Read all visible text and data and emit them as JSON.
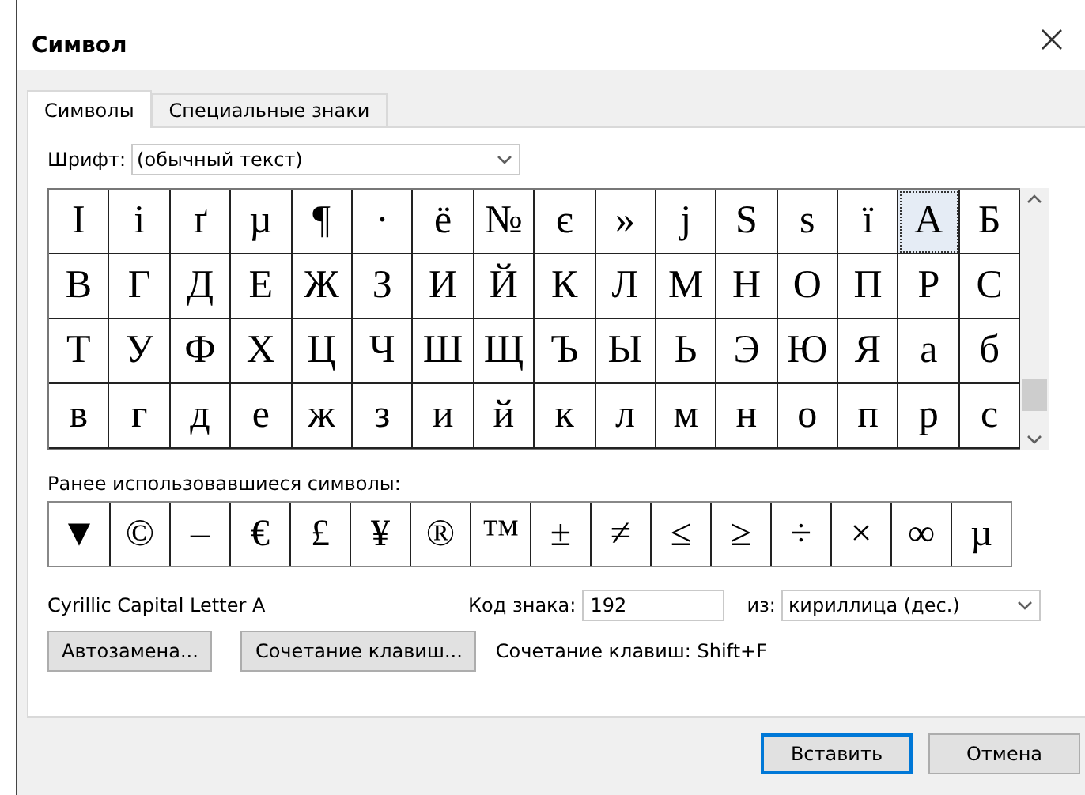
{
  "window": {
    "title": "Символ"
  },
  "tabs": [
    {
      "label": "Символы",
      "selected": true
    },
    {
      "label": "Специальные знаки",
      "selected": false
    }
  ],
  "font": {
    "label": "Шрифт:",
    "value": "(обычный текст)"
  },
  "symbols": [
    {
      "char": "І",
      "selected": false
    },
    {
      "char": "і",
      "selected": false
    },
    {
      "char": "ґ",
      "selected": false
    },
    {
      "char": "µ",
      "selected": false
    },
    {
      "char": "¶",
      "selected": false
    },
    {
      "char": "·",
      "selected": false
    },
    {
      "char": "ё",
      "selected": false
    },
    {
      "char": "№",
      "selected": false
    },
    {
      "char": "є",
      "selected": false
    },
    {
      "char": "»",
      "selected": false
    },
    {
      "char": "ј",
      "selected": false
    },
    {
      "char": "Ѕ",
      "selected": false
    },
    {
      "char": "ѕ",
      "selected": false
    },
    {
      "char": "ї",
      "selected": false
    },
    {
      "char": "А",
      "selected": true
    },
    {
      "char": "Б",
      "selected": false
    },
    {
      "char": "В",
      "selected": false
    },
    {
      "char": "Г",
      "selected": false
    },
    {
      "char": "Д",
      "selected": false
    },
    {
      "char": "Е",
      "selected": false
    },
    {
      "char": "Ж",
      "selected": false
    },
    {
      "char": "З",
      "selected": false
    },
    {
      "char": "И",
      "selected": false
    },
    {
      "char": "Й",
      "selected": false
    },
    {
      "char": "К",
      "selected": false
    },
    {
      "char": "Л",
      "selected": false
    },
    {
      "char": "М",
      "selected": false
    },
    {
      "char": "Н",
      "selected": false
    },
    {
      "char": "О",
      "selected": false
    },
    {
      "char": "П",
      "selected": false
    },
    {
      "char": "Р",
      "selected": false
    },
    {
      "char": "С",
      "selected": false
    },
    {
      "char": "Т",
      "selected": false
    },
    {
      "char": "У",
      "selected": false
    },
    {
      "char": "Ф",
      "selected": false
    },
    {
      "char": "Х",
      "selected": false
    },
    {
      "char": "Ц",
      "selected": false
    },
    {
      "char": "Ч",
      "selected": false
    },
    {
      "char": "Ш",
      "selected": false
    },
    {
      "char": "Щ",
      "selected": false
    },
    {
      "char": "Ъ",
      "selected": false
    },
    {
      "char": "Ы",
      "selected": false
    },
    {
      "char": "Ь",
      "selected": false
    },
    {
      "char": "Э",
      "selected": false
    },
    {
      "char": "Ю",
      "selected": false
    },
    {
      "char": "Я",
      "selected": false
    },
    {
      "char": "а",
      "selected": false
    },
    {
      "char": "б",
      "selected": false
    },
    {
      "char": "в",
      "selected": false
    },
    {
      "char": "г",
      "selected": false
    },
    {
      "char": "д",
      "selected": false
    },
    {
      "char": "е",
      "selected": false
    },
    {
      "char": "ж",
      "selected": false
    },
    {
      "char": "з",
      "selected": false
    },
    {
      "char": "и",
      "selected": false
    },
    {
      "char": "й",
      "selected": false
    },
    {
      "char": "к",
      "selected": false
    },
    {
      "char": "л",
      "selected": false
    },
    {
      "char": "м",
      "selected": false
    },
    {
      "char": "н",
      "selected": false
    },
    {
      "char": "о",
      "selected": false
    },
    {
      "char": "п",
      "selected": false
    },
    {
      "char": "р",
      "selected": false
    },
    {
      "char": "с",
      "selected": false
    }
  ],
  "recent_label": "Ранее использовавшиеся символы:",
  "recent": [
    "▼",
    "©",
    "–",
    "€",
    "£",
    "¥",
    "®",
    "™",
    "±",
    "≠",
    "≤",
    "≥",
    "÷",
    "×",
    "∞",
    "µ"
  ],
  "character_name": "Cyrillic Capital Letter A",
  "code": {
    "label": "Код знака:",
    "value": "192"
  },
  "from": {
    "label": "из:",
    "value": "кириллица (дес.)"
  },
  "buttons": [
    "Автозамена...",
    "Сочетание клавиш..."
  ],
  "shortcut_text": "Сочетание клавиш: Shift+F",
  "dialog_buttons": [
    {
      "label": "Вставить",
      "default": true
    },
    {
      "label": "Отмена",
      "default": false
    }
  ]
}
